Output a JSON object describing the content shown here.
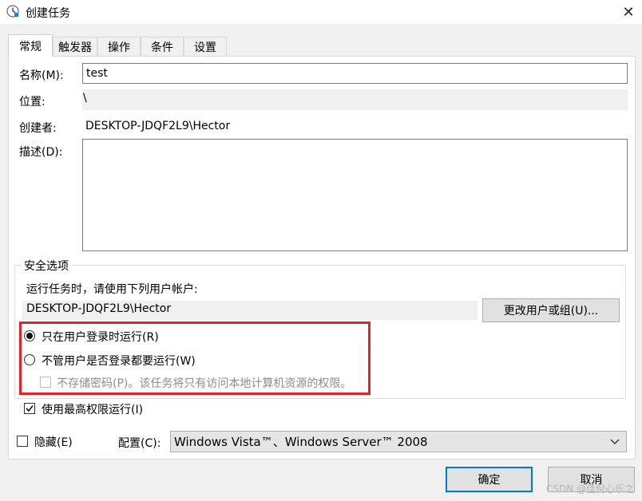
{
  "window": {
    "title": "创建任务",
    "close_glyph": "✕"
  },
  "tabs": [
    {
      "label": "常规",
      "active": true
    },
    {
      "label": "触发器"
    },
    {
      "label": "操作"
    },
    {
      "label": "条件"
    },
    {
      "label": "设置"
    }
  ],
  "general": {
    "name_label": "名称(M):",
    "name_value": "test",
    "location_label": "位置:",
    "location_value": "\\",
    "author_label": "创建者:",
    "author_value": "DESKTOP-JDQF2L9\\Hector",
    "description_label": "描述(D):",
    "description_value": ""
  },
  "security": {
    "group_title": "安全选项",
    "run_as_prompt": "运行任务时，请使用下列用户帐户:",
    "user_account": "DESKTOP-JDQF2L9\\Hector",
    "change_user_button": "更改用户或组(U)...",
    "radio_logged_on": "只在用户登录时运行(R)",
    "radio_logged_on_selected": true,
    "radio_whether_logged": "不管用户是否登录都要运行(W)",
    "radio_whether_logged_selected": false,
    "no_store_password": "不存储密码(P)。该任务将只有访问本地计算机资源的权限。",
    "no_store_password_checked": false,
    "highest_privileges": "使用最高权限运行(I)",
    "highest_privileges_checked": true,
    "highlight_color": "#e0222a"
  },
  "footer": {
    "hidden_label": "隐藏(E)",
    "hidden_checked": false,
    "configure_label": "配置(C):",
    "configure_value": "Windows Vista™、Windows Server™ 2008",
    "ok_button": "确定",
    "cancel_button": "取消",
    "watermark": "CSDN @佳倪心乐之"
  },
  "colors": {
    "accent": "#0078d7",
    "panel_bg": "#f0f0f0"
  }
}
